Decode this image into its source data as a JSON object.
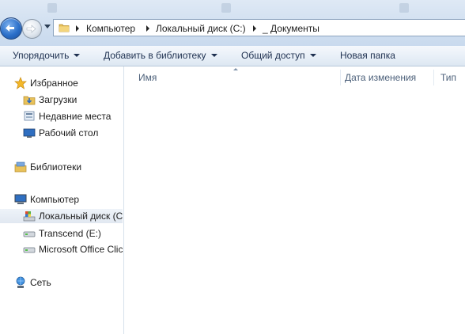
{
  "address": {
    "crumbs": [
      "Компьютер",
      "Локальный диск (C:)",
      "_ Документы"
    ]
  },
  "toolbar": {
    "organize": "Упорядочить",
    "add_library": "Добавить в библиотеку",
    "share": "Общий доступ",
    "new_folder": "Новая папка"
  },
  "nav": {
    "favorites": "Избранное",
    "downloads": "Загрузки",
    "recent": "Недавние места",
    "desktop": "Рабочий стол",
    "libraries": "Библиотеки",
    "computer": "Компьютер",
    "local_disk": "Локальный диск (C",
    "transcend": "Transcend (E:)",
    "office": "Microsoft Office Clic",
    "network": "Сеть"
  },
  "columns": {
    "name": "Имя",
    "date": "Дата изменения",
    "type": "Тип"
  },
  "colors": {
    "toolbar_bg": "#e9f0f8",
    "header_text": "#4c607a",
    "selected_bg": "#e1e8f1"
  }
}
